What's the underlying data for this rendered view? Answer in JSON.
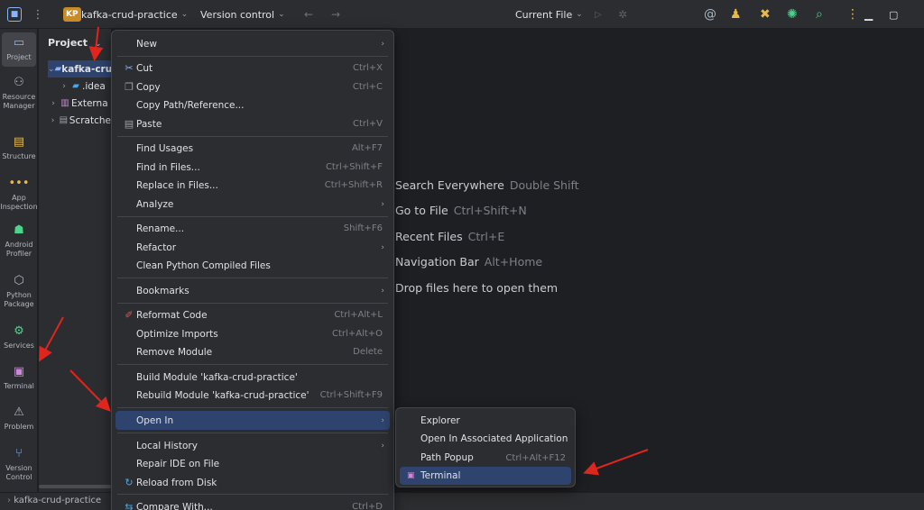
{
  "topbar": {
    "project_badge": "KP",
    "project_name": "kafka-crud-practice",
    "vcs_label": "Version control",
    "current_file": "Current File"
  },
  "sidebar": {
    "items": [
      {
        "label": "Project"
      },
      {
        "label": "Resource Manager"
      },
      {
        "label": "Structure"
      },
      {
        "label": "App Inspection"
      },
      {
        "label": "Android Profiler"
      },
      {
        "label": "Python Package"
      },
      {
        "label": "Services"
      },
      {
        "label": "Terminal"
      },
      {
        "label": "Problem"
      },
      {
        "label": "Version Control"
      }
    ]
  },
  "project_panel": {
    "title": "Project",
    "tree": [
      {
        "label": "kafka-cru"
      },
      {
        "label": ".idea"
      },
      {
        "label": "Externa"
      },
      {
        "label": "Scratche"
      }
    ]
  },
  "status_bar": {
    "breadcrumb": "kafka-crud-practice"
  },
  "editor_hints": [
    {
      "label": "Search Everywhere",
      "shortcut": "Double Shift"
    },
    {
      "label": "Go to File",
      "shortcut": "Ctrl+Shift+N"
    },
    {
      "label": "Recent Files",
      "shortcut": "Ctrl+E"
    },
    {
      "label": "Navigation Bar",
      "shortcut": "Alt+Home"
    },
    {
      "label": "Drop files here to open them",
      "shortcut": ""
    }
  ],
  "context_menu": {
    "items": [
      {
        "label": "New",
        "shortcut": ""
      },
      {
        "label": "Cut",
        "shortcut": "Ctrl+X"
      },
      {
        "label": "Copy",
        "shortcut": "Ctrl+C"
      },
      {
        "label": "Copy Path/Reference...",
        "shortcut": ""
      },
      {
        "label": "Paste",
        "shortcut": "Ctrl+V"
      },
      {
        "label": "Find Usages",
        "shortcut": "Alt+F7"
      },
      {
        "label": "Find in Files...",
        "shortcut": "Ctrl+Shift+F"
      },
      {
        "label": "Replace in Files...",
        "shortcut": "Ctrl+Shift+R"
      },
      {
        "label": "Analyze",
        "shortcut": ""
      },
      {
        "label": "Rename...",
        "shortcut": "Shift+F6"
      },
      {
        "label": "Refactor",
        "shortcut": ""
      },
      {
        "label": "Clean Python Compiled Files",
        "shortcut": ""
      },
      {
        "label": "Bookmarks",
        "shortcut": ""
      },
      {
        "label": "Reformat Code",
        "shortcut": "Ctrl+Alt+L"
      },
      {
        "label": "Optimize Imports",
        "shortcut": "Ctrl+Alt+O"
      },
      {
        "label": "Remove Module",
        "shortcut": "Delete"
      },
      {
        "label": "Build Module 'kafka-crud-practice'",
        "shortcut": ""
      },
      {
        "label": "Rebuild Module 'kafka-crud-practice'",
        "shortcut": "Ctrl+Shift+F9"
      },
      {
        "label": "Open In",
        "shortcut": ""
      },
      {
        "label": "Local History",
        "shortcut": ""
      },
      {
        "label": "Repair IDE on File",
        "shortcut": ""
      },
      {
        "label": "Reload from Disk",
        "shortcut": ""
      },
      {
        "label": "Compare With...",
        "shortcut": "Ctrl+D"
      }
    ]
  },
  "open_in_submenu": {
    "items": [
      {
        "label": "Explorer",
        "shortcut": ""
      },
      {
        "label": "Open In Associated Application",
        "shortcut": ""
      },
      {
        "label": "Path Popup",
        "shortcut": "Ctrl+Alt+F12"
      },
      {
        "label": "Terminal",
        "shortcut": ""
      }
    ]
  },
  "colors": {
    "background": "#1e1f22",
    "panel": "#2b2d30",
    "selection": "#2e436e",
    "annotation_arrow": "#e0251c"
  }
}
